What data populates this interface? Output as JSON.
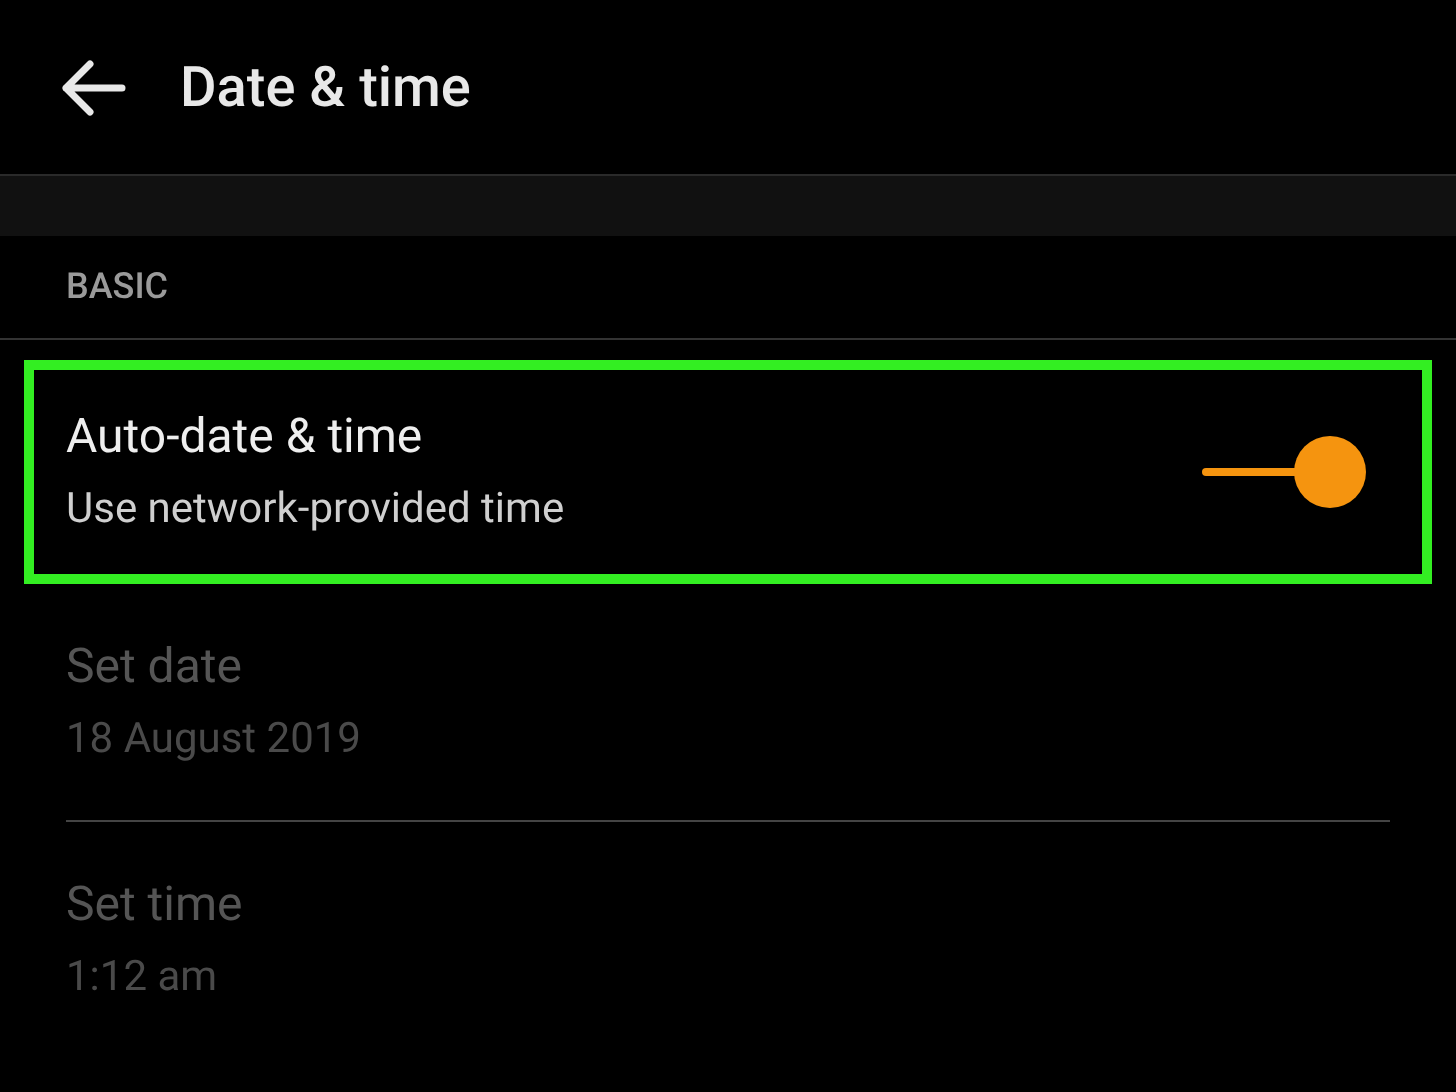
{
  "app_bar": {
    "title": "Date & time"
  },
  "section": {
    "header": "BASIC"
  },
  "settings": [
    {
      "kind": "switch",
      "title": "Auto-date & time",
      "summary": "Use network-provided time",
      "on": true,
      "disabled": false,
      "highlighted": true
    },
    {
      "kind": "plain",
      "title": "Set date",
      "summary": "18 August 2019",
      "disabled": true,
      "highlighted": false
    },
    {
      "kind": "plain",
      "title": "Set time",
      "summary": "1:12 am",
      "disabled": true,
      "highlighted": false
    }
  ]
}
